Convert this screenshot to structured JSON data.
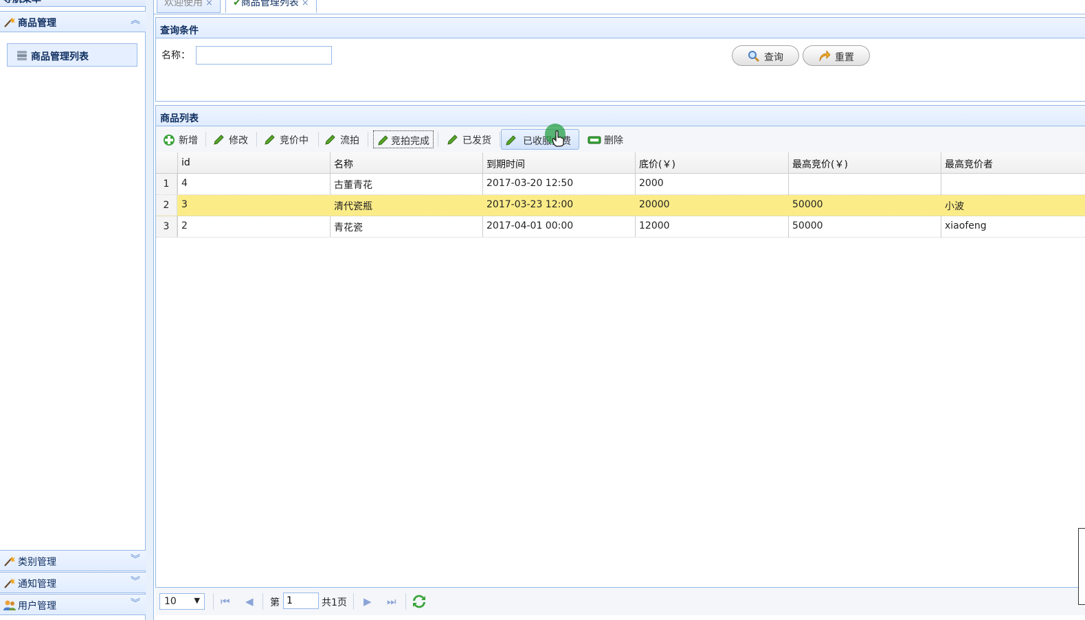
{
  "sidebar": {
    "title": "导航菜单",
    "sections": [
      {
        "label": "商品管理",
        "expanded": true,
        "items": [
          {
            "label": "商品管理列表"
          }
        ]
      },
      {
        "label": "类别管理",
        "expanded": false
      },
      {
        "label": "通知管理",
        "expanded": false
      },
      {
        "label": "用户管理",
        "expanded": false
      }
    ]
  },
  "tabs": [
    {
      "label": "欢迎使用",
      "close": "×"
    },
    {
      "label": "商品管理列表",
      "close": "×",
      "active": true
    }
  ],
  "query": {
    "title": "查询条件",
    "name_label": "名称：",
    "name_value": "",
    "search_label": "查询",
    "reset_label": "重置"
  },
  "list": {
    "title": "商品列表",
    "toolbar": [
      "新增",
      "修改",
      "竞价中",
      "流拍",
      "竞拍完成",
      "已发货",
      "已收服务费",
      "删除"
    ],
    "columns": [
      "id",
      "名称",
      "到期时间",
      "底价(￥)",
      "最高竞价(￥)",
      "最高竞价者"
    ],
    "rows": [
      {
        "num": "1",
        "id": "4",
        "name": "古董青花",
        "expire": "2017-03-20 12:50",
        "base": "2000",
        "top_bid": "",
        "bidder": ""
      },
      {
        "num": "2",
        "id": "3",
        "name": "清代瓷瓶",
        "expire": "2017-03-23 12:00",
        "base": "20000",
        "top_bid": "50000",
        "bidder": "小波"
      },
      {
        "num": "3",
        "id": "2",
        "name": "青花瓷",
        "expire": "2017-04-01 00:00",
        "base": "12000",
        "top_bid": "50000",
        "bidder": "xiaofeng"
      }
    ],
    "selected_row": 2
  },
  "pager": {
    "page_size": "10",
    "page_prefix": "第",
    "page_value": "1",
    "total": "共1页"
  },
  "colors": {
    "border": "#95b8e7",
    "header_text": "#0e2d5f",
    "selected_row": "#fbec88"
  }
}
